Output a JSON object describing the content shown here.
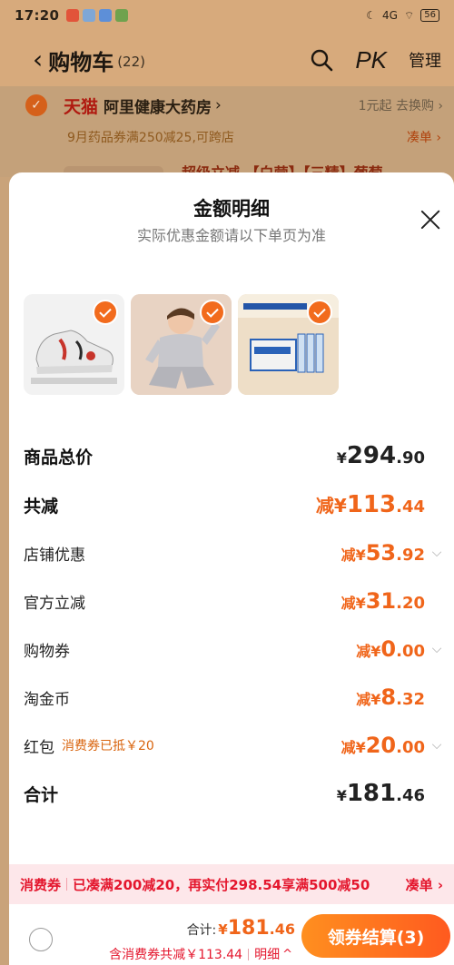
{
  "status_bar": {
    "time": "17:20",
    "network": "4G",
    "battery": "56"
  },
  "nav": {
    "back_icon": "chevron-left-icon",
    "title": "购物车",
    "count": "(22)",
    "pk_label": "PK",
    "manage_label": "管理"
  },
  "store": {
    "tmall_label": "天猫",
    "name": "阿里健康大药房",
    "chevron": "›",
    "exchange_text": "1元起 去换购 ›",
    "promo_text": "9月药品券满250减25,可跨店",
    "promo_action": "凑单 ›",
    "peek_text": "超级立减 【白营】【三精】葡萄"
  },
  "sheet": {
    "title": "金额明细",
    "subtitle": "实际优惠金额请以下单页为准",
    "products": [
      {
        "name": "shoe",
        "checked": true
      },
      {
        "name": "kids-pajamas",
        "checked": true
      },
      {
        "name": "zinc-gluconate-oral-solution",
        "checked": true
      }
    ],
    "rows": {
      "total": {
        "label": "商品总价",
        "prefix": "¥",
        "int": "294",
        "dec": ".90"
      },
      "discount": {
        "label": "共减",
        "prefix": "减¥",
        "int": "113",
        "dec": ".44"
      },
      "store_coupon": {
        "label": "店铺优惠",
        "prefix": "减¥",
        "int": "53",
        "dec": ".92"
      },
      "official": {
        "label": "官方立减",
        "prefix": "减¥",
        "int": "31",
        "dec": ".20"
      },
      "shopping_coupon": {
        "label": "购物券",
        "prefix": "减¥",
        "int": "0",
        "dec": ".00"
      },
      "taojinbi": {
        "label": "淘金币",
        "prefix": "减¥",
        "int": "8",
        "dec": ".32"
      },
      "red_packet": {
        "label": "红包",
        "tag": "消费券已抵￥20",
        "prefix": "减¥",
        "int": "20",
        "dec": ".00"
      },
      "sum": {
        "label": "合计",
        "prefix": "¥",
        "int": "181",
        "dec": ".46"
      }
    }
  },
  "promo_banner": {
    "tag": "消费券",
    "text": "已凑满200减20，再实付298.54享满500减50",
    "action": "凑单 ›"
  },
  "bottom_bar": {
    "total_label": "合计:",
    "total_prefix": "¥",
    "total_int": "181",
    "total_dec": ".46",
    "detail_text": "含消费券共减￥113.44",
    "detail_link": "明细",
    "checkout_label": "领券结算(3)"
  },
  "colors": {
    "accent": "#f0651a",
    "promo_red": "#e4162d",
    "check_orange": "#f26b1d"
  }
}
